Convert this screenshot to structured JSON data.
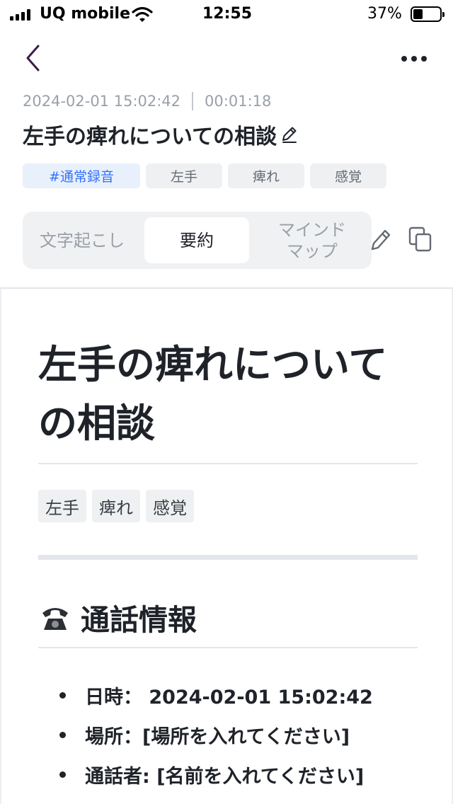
{
  "status_bar": {
    "carrier": "UQ mobile",
    "time": "12:55",
    "battery_percent": "37%",
    "battery_level": 0.37
  },
  "nav": {
    "back_icon": "chevron-left-icon",
    "more_icon": "more-horizontal-icon"
  },
  "recording": {
    "datetime": "2024-02-01 15:02:42",
    "duration": "00:01:18",
    "title": "左手の痺れについての相談",
    "tags": [
      "#通常録音",
      "左手",
      "痺れ",
      "感覚"
    ]
  },
  "tabs": {
    "transcript": "文字起こし",
    "summary": "要約",
    "mindmap_line1": "マインド",
    "mindmap_line2": "マップ",
    "active": "summary"
  },
  "document": {
    "title": "左手の痺れについての相談",
    "tags": [
      "左手",
      "痺れ",
      "感覚"
    ],
    "section_heading": "通話情報",
    "info_items": [
      "日時： 2024-02-01 15:02:42",
      "場所：[場所を入れてください]",
      "通話者: [名前を入れてください]"
    ]
  },
  "colors": {
    "accent": "#3370ff",
    "text": "#1f2329",
    "muted": "#9aa0a8"
  }
}
